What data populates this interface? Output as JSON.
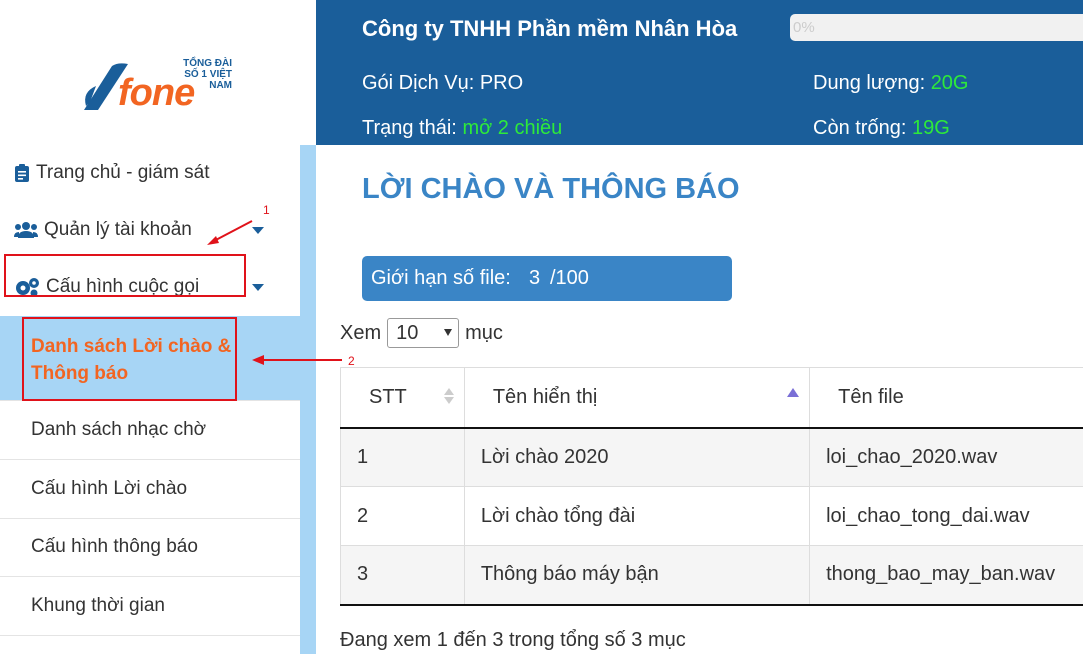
{
  "logo": {
    "tagline_1": "TỔNG ĐÀI",
    "tagline_2": "SỐ 1 VIỆT NAM",
    "word": "fone"
  },
  "sidebar": {
    "items": [
      {
        "label": "Trang chủ - giám sát",
        "icon": "clipboard-icon"
      },
      {
        "label": "Quản lý tài khoản",
        "icon": "users-icon"
      },
      {
        "label": "Cấu hình cuộc gọi",
        "icon": "gears-icon"
      }
    ],
    "submenu": [
      {
        "label_1": "Danh sách Lời chào &",
        "label_2": "Thông báo"
      },
      {
        "label": "Danh sách nhạc chờ"
      },
      {
        "label": "Cấu hình Lời chào"
      },
      {
        "label": "Cấu hình thông báo"
      },
      {
        "label": "Khung thời gian"
      }
    ]
  },
  "annotations": {
    "one": "1",
    "two": "2"
  },
  "header": {
    "company": "Công ty TNHH Phần mềm Nhân Hòa",
    "progress_text": "0%",
    "package_label": "Gói Dịch Vụ: PRO",
    "status_label": "Trạng thái:",
    "status_value": "mở 2 chiều",
    "capacity_label": "Dung lượng:",
    "capacity_value": "20G",
    "free_label": "Còn trống:",
    "free_value": "19G"
  },
  "main": {
    "title": "LỜI CHÀO VÀ THÔNG BÁO",
    "limit_label": "Giới hạn số file:",
    "limit_count": "3",
    "limit_max": "/100",
    "show_prefix": "Xem",
    "show_value": "10",
    "show_suffix": "mục",
    "columns": [
      "STT",
      "Tên hiển thị",
      "Tên file"
    ],
    "rows": [
      [
        "1",
        "Lời chào 2020",
        "loi_chao_2020.wav"
      ],
      [
        "2",
        "Lời chào tổng đài",
        "loi_chao_tong_dai.wav"
      ],
      [
        "3",
        "Thông báo máy bận",
        "thong_bao_may_ban.wav"
      ]
    ],
    "info": "Đang xem 1 đến 3 trong tổng số 3 mục"
  },
  "colors": {
    "header": "#1a5e9a",
    "accent": "#3a85c6",
    "active_bg": "#a7d5f5",
    "active_text": "#f26522",
    "status_green": "#2dea3a",
    "annotation": "#e0121a"
  }
}
